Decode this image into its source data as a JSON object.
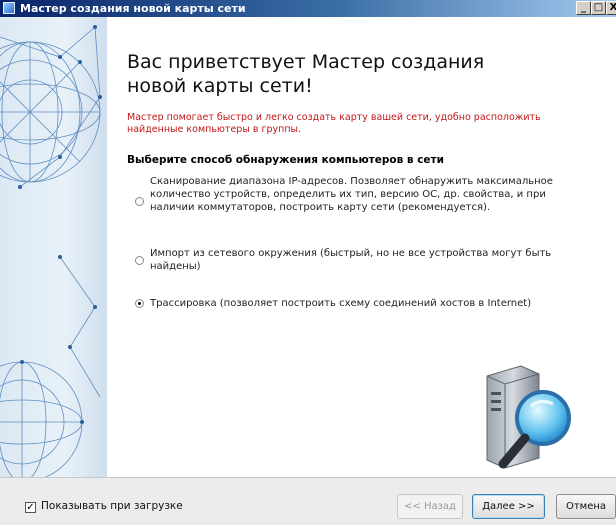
{
  "window": {
    "title": "Мастер создания новой карты сети",
    "minimize_glyph": "_",
    "maximize_glyph": "□",
    "close_glyph": "X"
  },
  "main": {
    "heading": "Вас приветствует Мастер создания новой карты сети!",
    "intro": "Мастер помогает быстро и легко создать карту вашей сети, удобно расположить найденные компьютеры в группы.",
    "section_title": "Выберите способ обнаружения компьютеров в сети",
    "options": [
      {
        "label": "Сканирование диапазона IP-адресов. Позволяет обнаружить максимальное количество устройств, определить их тип, версию ОС, др. свойства, и при наличии коммутаторов, построить карту сети (рекомендуется).",
        "selected": false
      },
      {
        "label": "Импорт из сетевого окружения (быстрый, но не все устройства могут быть найдены)",
        "selected": false
      },
      {
        "label": "Трассировка (позволяет построить схему соединений хостов в Internet)",
        "selected": true
      }
    ]
  },
  "footer": {
    "show_on_startup_label": "Показывать при загрузке",
    "show_on_startup_checked": true,
    "check_glyph": "✓",
    "back_label": "<< Назад",
    "next_label": "Далее >>",
    "cancel_label": "Отмена"
  },
  "icons": [
    "app-icon",
    "network-globe-icon",
    "computer-search-icon"
  ],
  "colors": {
    "intro_text": "#c01818",
    "title_bar": "#0a246a",
    "accent_button_border": "#3c7fb1"
  }
}
